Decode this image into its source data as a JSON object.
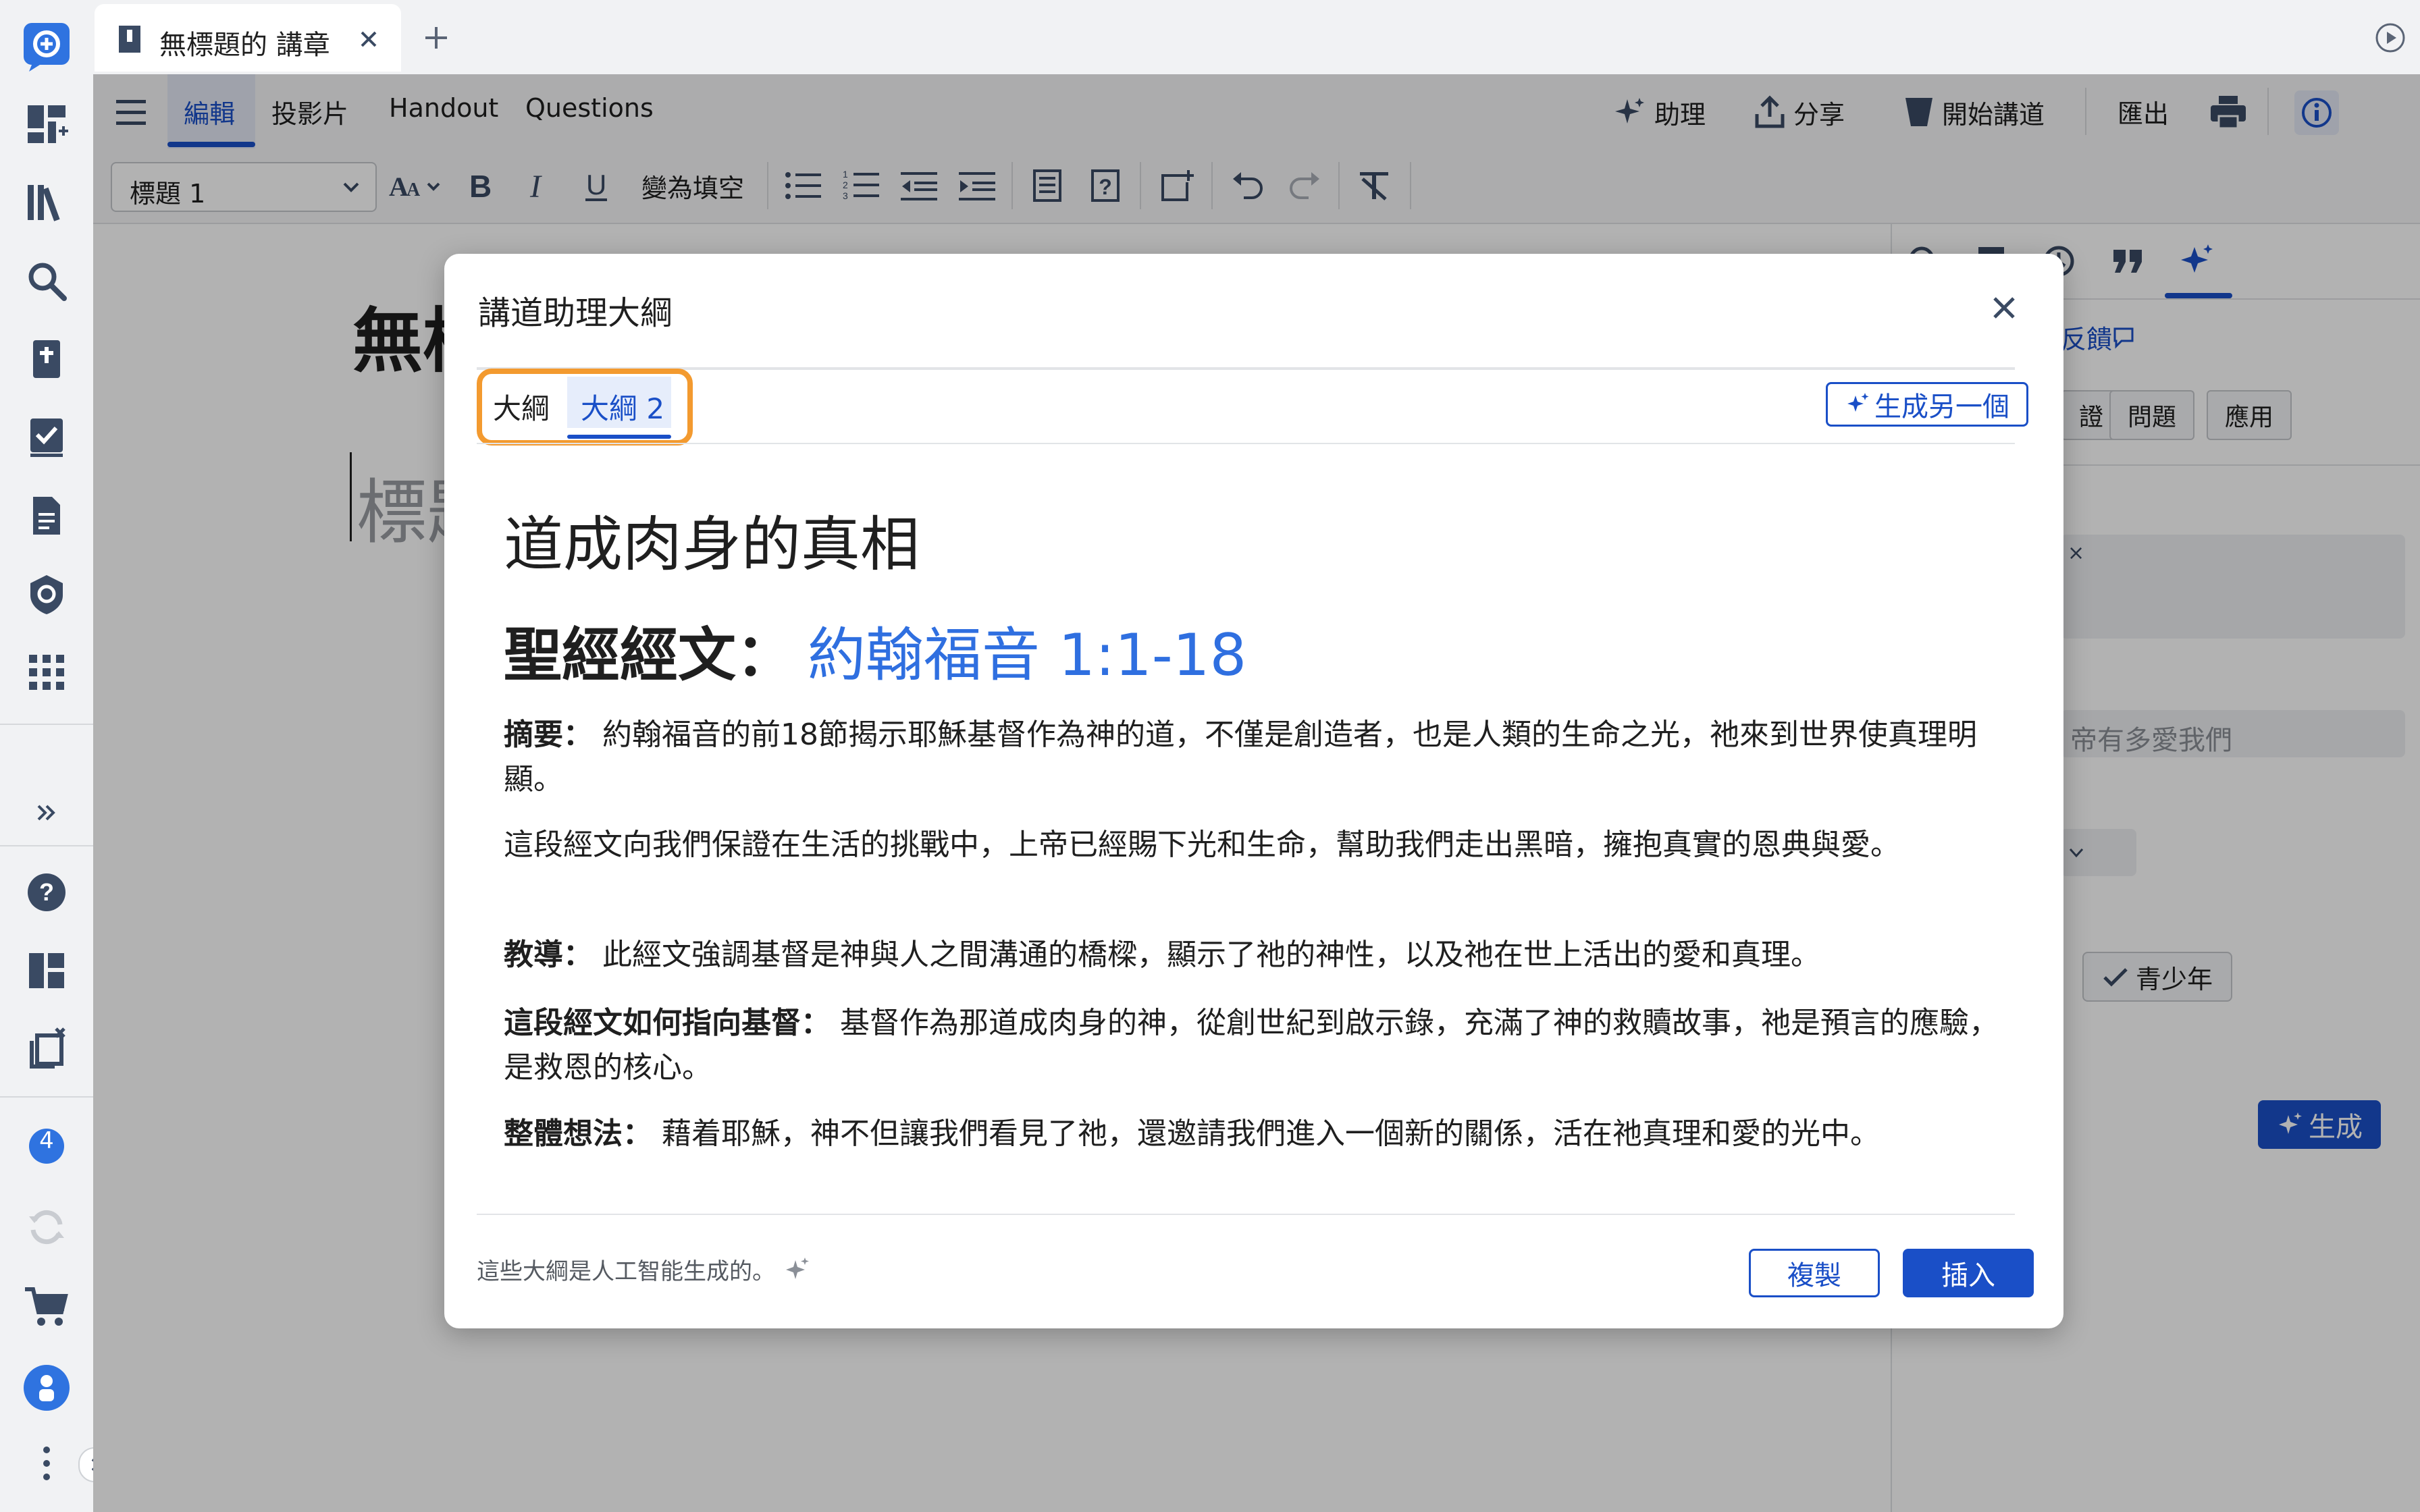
{
  "window": {
    "tab_title": "無標題的 講章"
  },
  "menubar": {
    "tabs": [
      "編輯",
      "投影片",
      "Handout",
      "Questions"
    ],
    "assistant": "助理",
    "share": "分享",
    "start_preaching": "開始講道",
    "export": "匯出"
  },
  "formatbar": {
    "style_value": "標題 1",
    "cloze": "變為填空"
  },
  "document": {
    "title_partial": "無標",
    "heading_placeholder": "標題"
  },
  "sidebar": {
    "feedback": "反饋",
    "chips": [
      "證",
      "問題",
      "應用"
    ],
    "close_x": "×",
    "prompt_text": "帝有多愛我們",
    "audience_chip": "青少年",
    "generate": "生成"
  },
  "rail": {
    "badge_count": "4"
  },
  "modal": {
    "title": "講道助理大綱",
    "tabs": [
      "大綱",
      "大綱 2"
    ],
    "generate_another": "生成另一個",
    "outline_title": "道成肉身的真相",
    "scripture_label": "聖經經文：",
    "scripture_ref": "約翰福音 1:1-18",
    "summary_label": "摘要：",
    "summary_text": "約翰福音的前18節揭示耶穌基督作為神的道，不僅是創造者，也是人類的生命之光，祂來到世界使真理明顯。",
    "para2": "這段經文向我們保證在生活的挑戰中，上帝已經賜下光和生命，幫助我們走出黑暗，擁抱真實的恩典與愛。",
    "teaching_label": "教導：",
    "teaching_text": "此經文強調基督是神與人之間溝通的橋樑，顯示了祂的神性，以及祂在世上活出的愛和真理。",
    "christ_label": "這段經文如何指向基督：",
    "christ_text": "基督作為那道成肉身的神，從創世紀到啟示錄，充滿了神的救贖故事，祂是預言的應驗，是救恩的核心。",
    "overall_label": "整體想法：",
    "overall_text": "藉着耶穌，神不但讓我們看見了祂，還邀請我們進入一個新的關係，活在祂真理和愛的光中。",
    "footer_note": "這些大綱是人工智能生成的。",
    "copy": "複製",
    "insert": "插入"
  },
  "colors": {
    "accent": "#1a4fc7",
    "link_blue": "#2f6fe0",
    "highlight": "#f39a2f"
  }
}
